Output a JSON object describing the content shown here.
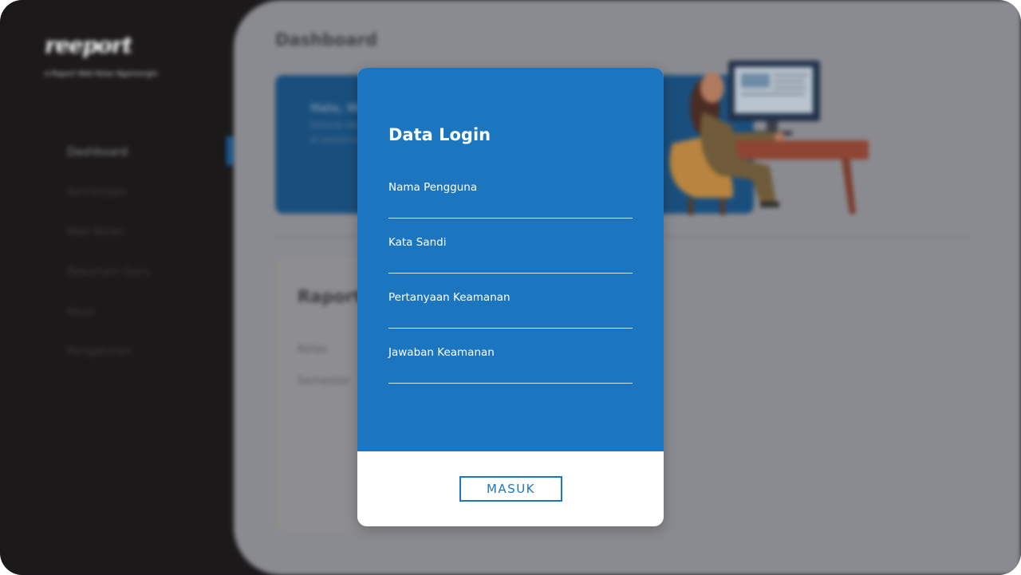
{
  "app": {
    "logo_text": "reeport",
    "tagline": "e-Raport Wali Kelas Ngomongin",
    "sidebar": {
      "items": [
        {
          "label": "Dashboard"
        },
        {
          "label": "Semboyan"
        },
        {
          "label": "Wali Kelas"
        },
        {
          "label": "Rekomen Guru"
        },
        {
          "label": "Akun"
        },
        {
          "label": "Pengaturan"
        }
      ]
    },
    "main": {
      "page_title": "Dashboard",
      "hero": {
        "line1": "Halo, Wa",
        "line2": "Selamat dat",
        "line3": "di repository"
      },
      "report": {
        "title": "Raport",
        "labels": [
          "Kelas",
          "Semester"
        ]
      }
    }
  },
  "modal": {
    "title": "Data Login",
    "fields": [
      {
        "label": "Nama Pengguna",
        "value": ""
      },
      {
        "label": "Kata Sandi",
        "value": ""
      },
      {
        "label": "Pertanyaan Keamanan",
        "value": ""
      },
      {
        "label": "Jawaban Keamanan",
        "value": ""
      }
    ],
    "submit_label": "MASUK"
  },
  "colors": {
    "modal_blue": "#1c76bf",
    "sidebar_bg": "#1b191a",
    "overlay_gray": "#8a8b90"
  }
}
